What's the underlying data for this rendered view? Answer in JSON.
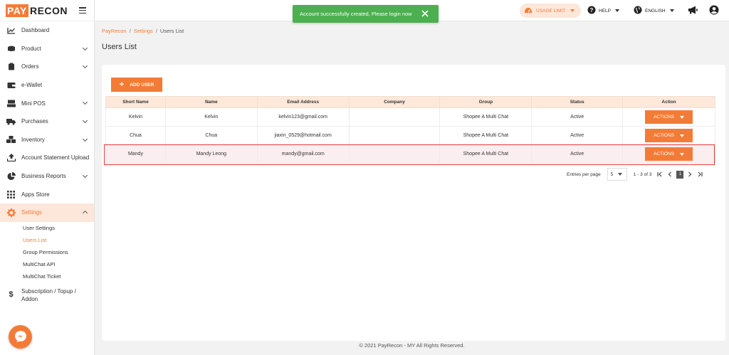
{
  "app": {
    "logo_pay": "PAY",
    "logo_recon": "RECON"
  },
  "colors": {
    "accent": "#f47b36",
    "accent_light": "#fde7da",
    "success": "#4caf50",
    "highlight_outline": "#e53935"
  },
  "sidebar": {
    "items": [
      {
        "label": "Dashboard",
        "icon": "chart-line-icon"
      },
      {
        "label": "Product",
        "icon": "product-box-icon",
        "expandable": true
      },
      {
        "label": "Orders",
        "icon": "clipboard-icon",
        "expandable": true
      },
      {
        "label": "e-Wallet",
        "icon": "wallet-icon"
      },
      {
        "label": "Mini POS",
        "icon": "pos-terminal-icon",
        "expandable": true
      },
      {
        "label": "Purchases",
        "icon": "truck-icon",
        "expandable": true
      },
      {
        "label": "Inventory",
        "icon": "boxes-icon",
        "expandable": true
      },
      {
        "label": "Account Statement Upload",
        "icon": "upload-icon"
      },
      {
        "label": "Business Reports",
        "icon": "pie-chart-icon",
        "expandable": true
      },
      {
        "label": "Apps Store",
        "icon": "grid-icon"
      },
      {
        "label": "Settings",
        "icon": "gear-icon",
        "expandable": true,
        "expanded": true,
        "active": true
      }
    ],
    "settings_sub": [
      {
        "label": "User Settings"
      },
      {
        "label": "Users List",
        "active": true
      },
      {
        "label": "Group Permissions"
      },
      {
        "label": "MultiChat API"
      },
      {
        "label": "MultiChat Ticket"
      }
    ],
    "subscription_line1": "Subscription / Topup /",
    "subscription_line2": "Addon"
  },
  "topbar": {
    "usage_limit": "USAGE LIMIT",
    "help": "HELP",
    "language": "ENGLISH"
  },
  "toast": {
    "message": "Account successfully created, Please login now"
  },
  "breadcrumb": {
    "crumb1": "PayRecon",
    "crumb2": "Settings",
    "crumb3": "Users List",
    "separator": "/"
  },
  "page": {
    "title": "Users List",
    "add_user": "ADD USER"
  },
  "table": {
    "headers": [
      "Short Name",
      "Name",
      "Email Address",
      "Company",
      "Group",
      "Status",
      "Action"
    ],
    "actions_label": "ACTIONS",
    "rows": [
      {
        "short_name": "Kelvin",
        "name": "Kelvin",
        "email": "kelvin123@gmail.com",
        "company": "",
        "group": "Shopee A Multi Chat",
        "status": "Active"
      },
      {
        "short_name": "Chua",
        "name": "Chua",
        "email": "jiaxin_0529@hotmail.com",
        "company": "",
        "group": "Shopee A Multi Chat",
        "status": "Active"
      },
      {
        "short_name": "Mandy",
        "name": "Mandy Leong",
        "email": "mandy@gmail.com",
        "company": "",
        "group": "Shopee A Multi Chat",
        "status": "Active",
        "highlighted": true
      }
    ]
  },
  "pagination": {
    "entries_label": "Entries per page",
    "per_page": "5",
    "range": "1 - 3 of 3",
    "current_page": "1"
  },
  "footer": {
    "text": "© 2021 PayRecon - MY All Rights Reserved."
  }
}
